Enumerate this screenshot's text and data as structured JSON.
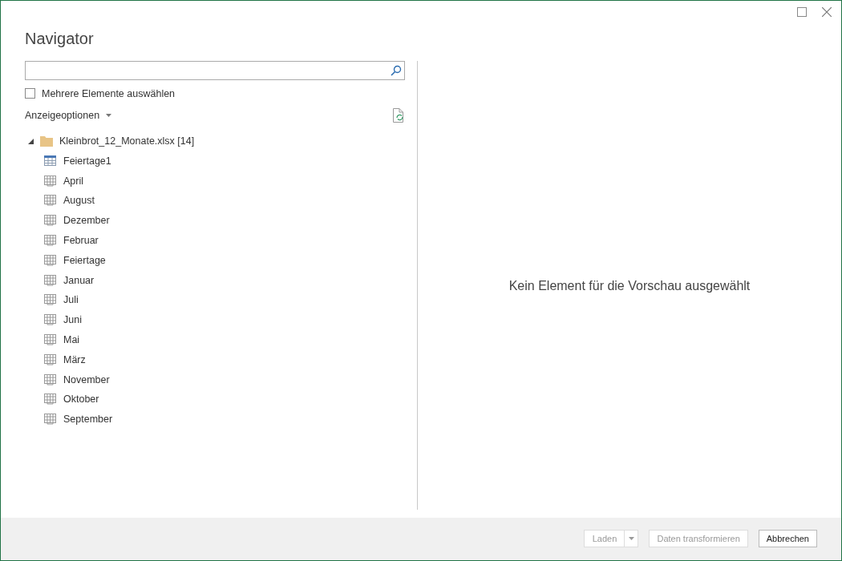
{
  "window": {
    "title": "Navigator"
  },
  "multi_select": {
    "label": "Mehrere Elemente auswählen",
    "checked": false
  },
  "display_options": {
    "label": "Anzeigeoptionen"
  },
  "tree": [
    {
      "label": "Kleinbrot_12_Monate.xlsx [14]",
      "kind": "file",
      "expanded": true,
      "children": [
        {
          "label": "Feiertage1",
          "kind": "table"
        },
        {
          "label": "April",
          "kind": "sheet"
        },
        {
          "label": "August",
          "kind": "sheet"
        },
        {
          "label": "Dezember",
          "kind": "sheet"
        },
        {
          "label": "Februar",
          "kind": "sheet"
        },
        {
          "label": "Feiertage",
          "kind": "sheet"
        },
        {
          "label": "Januar",
          "kind": "sheet"
        },
        {
          "label": "Juli",
          "kind": "sheet"
        },
        {
          "label": "Juni",
          "kind": "sheet"
        },
        {
          "label": "Mai",
          "kind": "sheet"
        },
        {
          "label": "März",
          "kind": "sheet"
        },
        {
          "label": "November",
          "kind": "sheet"
        },
        {
          "label": "Oktober",
          "kind": "sheet"
        },
        {
          "label": "September",
          "kind": "sheet"
        }
      ]
    }
  ],
  "preview": {
    "message": "Kein Element für die Vorschau ausgewählt"
  },
  "buttons": [
    {
      "label": "Laden",
      "kind": "split",
      "disabled": true
    },
    {
      "label": "Daten transformieren",
      "kind": "plain",
      "disabled": true
    },
    {
      "label": "Abbrechen",
      "kind": "plain",
      "disabled": false
    }
  ]
}
